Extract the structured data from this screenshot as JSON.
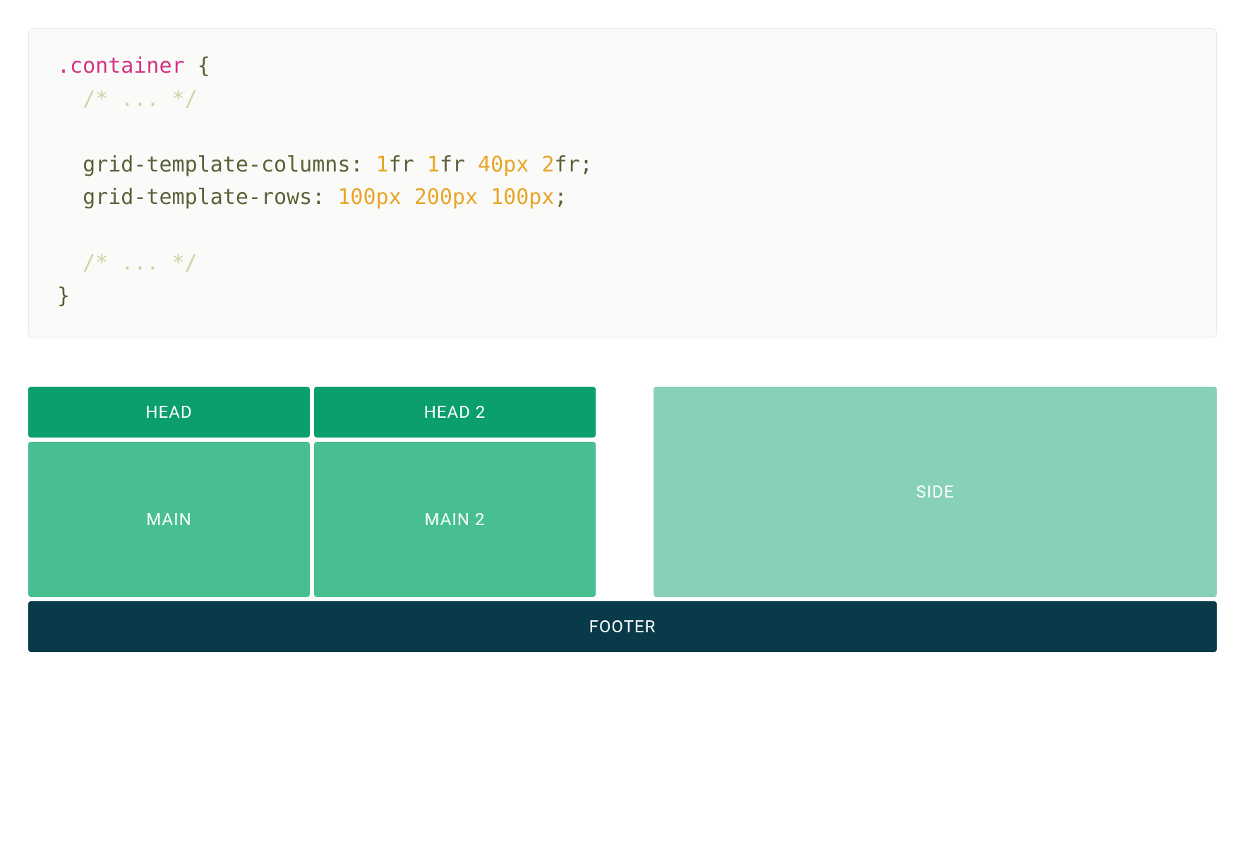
{
  "code": {
    "selector": ".container",
    "brace_open": " {",
    "brace_close": "}",
    "indent": "  ",
    "comment": "/* ... */",
    "prop_cols": "grid-template-columns",
    "prop_rows": "grid-template-rows",
    "colon_sp": ": ",
    "semicolon": ";",
    "cols_n1": "1",
    "cols_u1": "fr ",
    "cols_n2": "1",
    "cols_u2": "fr ",
    "cols_n3": "40px ",
    "cols_n4": "2",
    "cols_u4": "fr",
    "rows_n1": "100px ",
    "rows_n2": "200px ",
    "rows_n3": "100px"
  },
  "grid": {
    "head1": "HEAD",
    "head2": "HEAD 2",
    "main1": "MAIN",
    "main2": "MAIN 2",
    "side": "SIDE",
    "footer": "FOOTER"
  }
}
